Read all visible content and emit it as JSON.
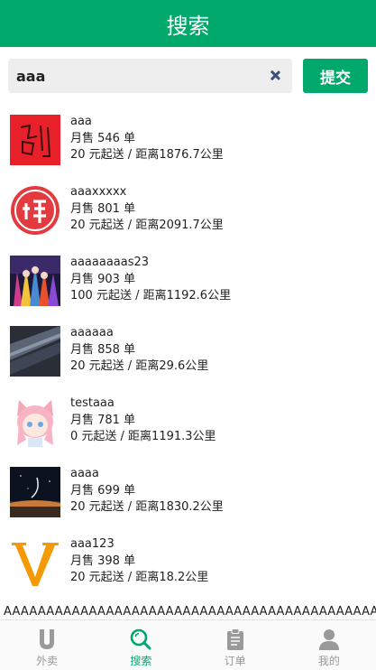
{
  "header": {
    "title": "搜索"
  },
  "search": {
    "value": "aaa",
    "submit_label": "提交"
  },
  "shops": [
    {
      "name": "aaa",
      "monthly_sales": "月售 546 单",
      "delivery": "20 元起送 / 距离1876.7公里",
      "thumb": "red-calligraphy-logo"
    },
    {
      "name": "aaaxxxxx",
      "monthly_sales": "月售 801 单",
      "delivery": "20 元起送 / 距离2091.7公里",
      "thumb": "pin-circle-logo"
    },
    {
      "name": "aaaaaaaas23",
      "monthly_sales": "月售 903 单",
      "delivery": "100 元起送 / 距离1192.6公里",
      "thumb": "anime-group-image"
    },
    {
      "name": "aaaaaa",
      "monthly_sales": "月售 858 单",
      "delivery": "20 元起送 / 距离29.6公里",
      "thumb": "dark-texture-image"
    },
    {
      "name": "testaaa",
      "monthly_sales": "月售 781 单",
      "delivery": "0 元起送 / 距离1191.3公里",
      "thumb": "pink-cat-girl-image"
    },
    {
      "name": "aaaa",
      "monthly_sales": "月售 699 单",
      "delivery": "20 元起送 / 距离1830.2公里",
      "thumb": "night-sky-image"
    },
    {
      "name": "aaa123",
      "monthly_sales": "月售 398 单",
      "delivery": "20 元起送 / 距离18.2公里",
      "thumb": "orange-v-logo"
    }
  ],
  "overflow_text": "AAAAAAAAAAAAAAAAAAAAAAAAAAAAAAAAAAAAAAAAAAAAAAAAAAAAAAAAAAAAAAAA",
  "tabs": [
    {
      "label": "外卖",
      "icon": "takeout-icon",
      "active": false
    },
    {
      "label": "搜索",
      "icon": "search-icon",
      "active": true
    },
    {
      "label": "订单",
      "icon": "clipboard-icon",
      "active": false
    },
    {
      "label": "我的",
      "icon": "user-icon",
      "active": false
    }
  ],
  "colors": {
    "brand": "#00a86b",
    "inactive": "#999999"
  }
}
